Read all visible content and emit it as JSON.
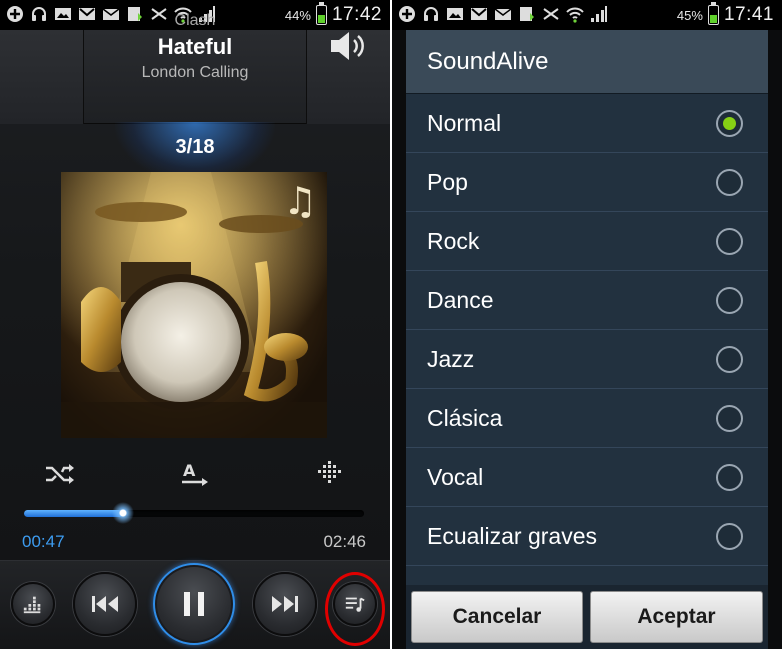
{
  "left": {
    "status": {
      "battery_pct": "44%",
      "time": "17:42",
      "battery_level": 0.44
    },
    "track": {
      "artist": "Clash",
      "song": "Hateful",
      "album": "London Calling"
    },
    "counter": "3/18",
    "progress": {
      "current": "00:47",
      "total": "02:46",
      "fraction": 0.29
    },
    "icons": [
      "shuffle-icon",
      "text-icon",
      "visualizer-icon"
    ],
    "bottom_buttons": [
      "equalizer-button",
      "previous-button",
      "pause-button",
      "next-button",
      "playlist-button"
    ]
  },
  "right": {
    "status": {
      "battery_pct": "45%",
      "time": "17:41",
      "battery_level": 0.45
    },
    "dialog": {
      "title": "SoundAlive",
      "options": [
        {
          "label": "Normal",
          "selected": true
        },
        {
          "label": "Pop",
          "selected": false
        },
        {
          "label": "Rock",
          "selected": false
        },
        {
          "label": "Dance",
          "selected": false
        },
        {
          "label": "Jazz",
          "selected": false
        },
        {
          "label": "Clásica",
          "selected": false
        },
        {
          "label": "Vocal",
          "selected": false
        },
        {
          "label": "Ecualizar graves",
          "selected": false
        }
      ],
      "cancel_label": "Cancelar",
      "accept_label": "Aceptar"
    }
  },
  "colors": {
    "accent_blue": "#3d9cf0",
    "radio_selected": "#86d114",
    "highlight_ring": "#e00000"
  }
}
